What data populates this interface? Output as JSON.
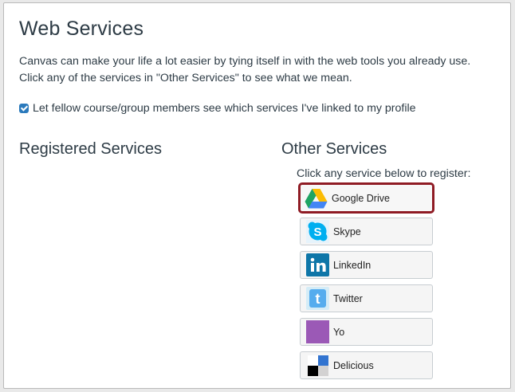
{
  "page": {
    "title": "Web Services",
    "intro": "Canvas can make your life a lot easier by tying itself in with the web tools you already use. Click any of the services in \"Other Services\" to see what we mean.",
    "share_checkbox": {
      "label": "Let fellow course/group members see which services I've linked to my profile",
      "checked": true
    }
  },
  "registered": {
    "title": "Registered Services"
  },
  "other": {
    "title": "Other Services",
    "hint": "Click any service below to register:",
    "services": [
      {
        "label": "Google Drive",
        "icon": "google-drive-icon",
        "highlighted": true
      },
      {
        "label": "Skype",
        "icon": "skype-icon"
      },
      {
        "label": "LinkedIn",
        "icon": "linkedin-icon"
      },
      {
        "label": "Twitter",
        "icon": "twitter-icon"
      },
      {
        "label": "Yo",
        "icon": "yo-icon"
      },
      {
        "label": "Delicious",
        "icon": "delicious-icon"
      }
    ]
  },
  "colors": {
    "checkbox": "#2b7abc",
    "highlight_border": "#8f1b24",
    "yo": "#9b59b6",
    "linkedin": "#0e76a8"
  }
}
